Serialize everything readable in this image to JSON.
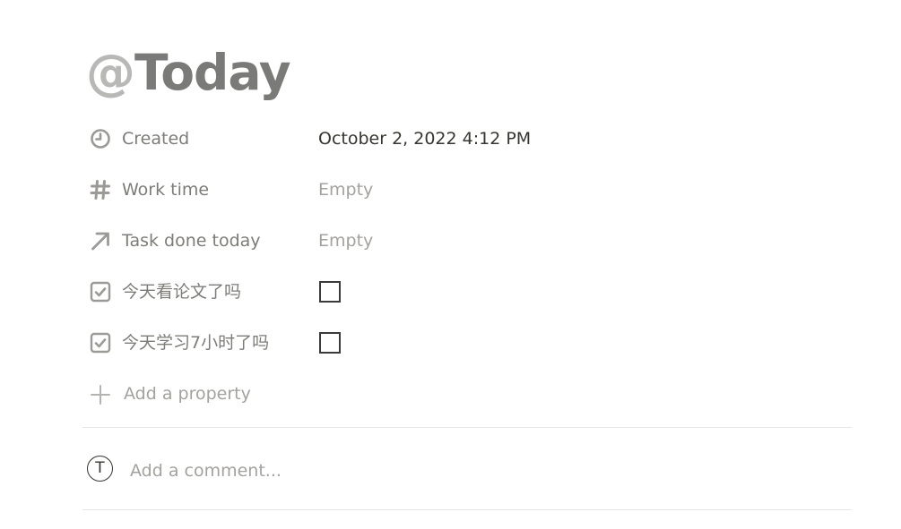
{
  "page": {
    "title_prefix": "@",
    "title": "Today"
  },
  "properties": [
    {
      "icon": "clock-icon",
      "label": "Created",
      "value": "October 2, 2022 4:12 PM",
      "type": "created_time"
    },
    {
      "icon": "hash-icon",
      "label": "Work time",
      "value": "Empty",
      "type": "number"
    },
    {
      "icon": "arrow-up-right-icon",
      "label": "Task done today",
      "value": "Empty",
      "type": "relation"
    },
    {
      "icon": "checkbox-icon",
      "label": "今天看论文了吗",
      "checked": false,
      "type": "checkbox"
    },
    {
      "icon": "checkbox-icon",
      "label": "今天学习7小时了吗",
      "checked": false,
      "type": "checkbox"
    }
  ],
  "add_property": {
    "label": "Add a property"
  },
  "comment": {
    "avatar_initial": "T",
    "placeholder": "Add a comment..."
  },
  "colors": {
    "title": "#7a7a78",
    "label": "#7d7c78",
    "value": "#37352f",
    "placeholder": "#a3a29e",
    "divider": "#e6e6e4"
  }
}
